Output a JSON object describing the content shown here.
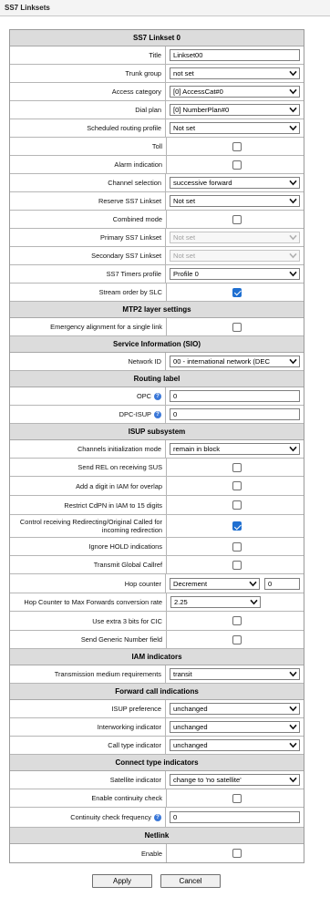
{
  "window": {
    "title": "SS7 Linksets"
  },
  "sections": {
    "linkset": "SS7 Linkset 0",
    "mtp2": "MTP2 layer settings",
    "sio": "Service Information (SIO)",
    "routing": "Routing label",
    "isup": "ISUP subsystem",
    "iam": "IAM indicators",
    "forward": "Forward call indications",
    "connect": "Connect type indicators",
    "netlink": "Netlink"
  },
  "fields": {
    "title": {
      "label": "Title",
      "value": "Linkset00"
    },
    "trunk_group": {
      "label": "Trunk group",
      "value": "not set"
    },
    "access_category": {
      "label": "Access category",
      "value": "[0] AccessCat#0"
    },
    "dial_plan": {
      "label": "Dial plan",
      "value": "[0] NumberPlan#0"
    },
    "scheduled_routing": {
      "label": "Scheduled routing profile",
      "value": "Not set"
    },
    "toll": {
      "label": "Toll",
      "checked": false
    },
    "alarm_indication": {
      "label": "Alarm indication",
      "checked": false
    },
    "channel_selection": {
      "label": "Channel selection",
      "value": "successive forward"
    },
    "reserve_linkset": {
      "label": "Reserve SS7 Linkset",
      "value": "Not set"
    },
    "combined_mode": {
      "label": "Combined mode",
      "checked": false
    },
    "primary_linkset": {
      "label": "Primary SS7 Linkset",
      "value": "Not set"
    },
    "secondary_linkset": {
      "label": "Secondary SS7 Linkset",
      "value": "Not set"
    },
    "timers_profile": {
      "label": "SS7 Timers profile",
      "value": "Profile 0"
    },
    "stream_order": {
      "label": "Stream order by SLC",
      "checked": true
    },
    "emergency_alignment": {
      "label": "Emergency alignment for a single link",
      "checked": false
    },
    "network_id": {
      "label": "Network ID",
      "value": "00 - international network (DEC"
    },
    "opc": {
      "label": "OPC",
      "value": "0"
    },
    "dpc_isup": {
      "label": "DPC-ISUP",
      "value": "0"
    },
    "channels_init_mode": {
      "label": "Channels initialization mode",
      "value": "remain in block"
    },
    "send_rel_sus": {
      "label": "Send REL on receiving SUS",
      "checked": false
    },
    "add_digit_iam": {
      "label": "Add a digit in IAM for overlap",
      "checked": false
    },
    "restrict_cdpn": {
      "label": "Restrict CdPN in IAM to 15 digits",
      "checked": false
    },
    "control_redirecting": {
      "label": "Control receiving Redirecting/Original Called for incoming redirection",
      "checked": true
    },
    "ignore_hold": {
      "label": "Ignore HOLD indications",
      "checked": false
    },
    "transmit_callref": {
      "label": "Transmit Global Callref",
      "checked": false
    },
    "hop_counter": {
      "label": "Hop counter",
      "value": "Decrement",
      "number": "0"
    },
    "hop_conversion": {
      "label": "Hop Counter to Max Forwards conversion rate",
      "value": "2.25"
    },
    "extra_bits_cic": {
      "label": "Use extra 3 bits for CIC",
      "checked": false
    },
    "send_generic_number": {
      "label": "Send Generic Number field",
      "checked": false
    },
    "transmission_medium": {
      "label": "Transmission medium requirements",
      "value": "transit"
    },
    "isup_preference": {
      "label": "ISUP preference",
      "value": "unchanged"
    },
    "interworking_indicator": {
      "label": "Interworking indicator",
      "value": "unchanged"
    },
    "call_type_indicator": {
      "label": "Call type indicator",
      "value": "unchanged"
    },
    "satellite_indicator": {
      "label": "Satellite indicator",
      "value": "change to 'no satellite'"
    },
    "continuity_check": {
      "label": "Enable continuity check",
      "checked": false
    },
    "continuity_frequency": {
      "label": "Continuity check frequency",
      "value": "0"
    },
    "netlink_enable": {
      "label": "Enable",
      "checked": false
    }
  },
  "buttons": {
    "apply": "Apply",
    "cancel": "Cancel"
  },
  "icons": {
    "help": "help-icon",
    "dropdown": "chevron-down-icon"
  },
  "colors": {
    "accent": "#1f6fd1",
    "section_bg": "#dcdcdc"
  }
}
